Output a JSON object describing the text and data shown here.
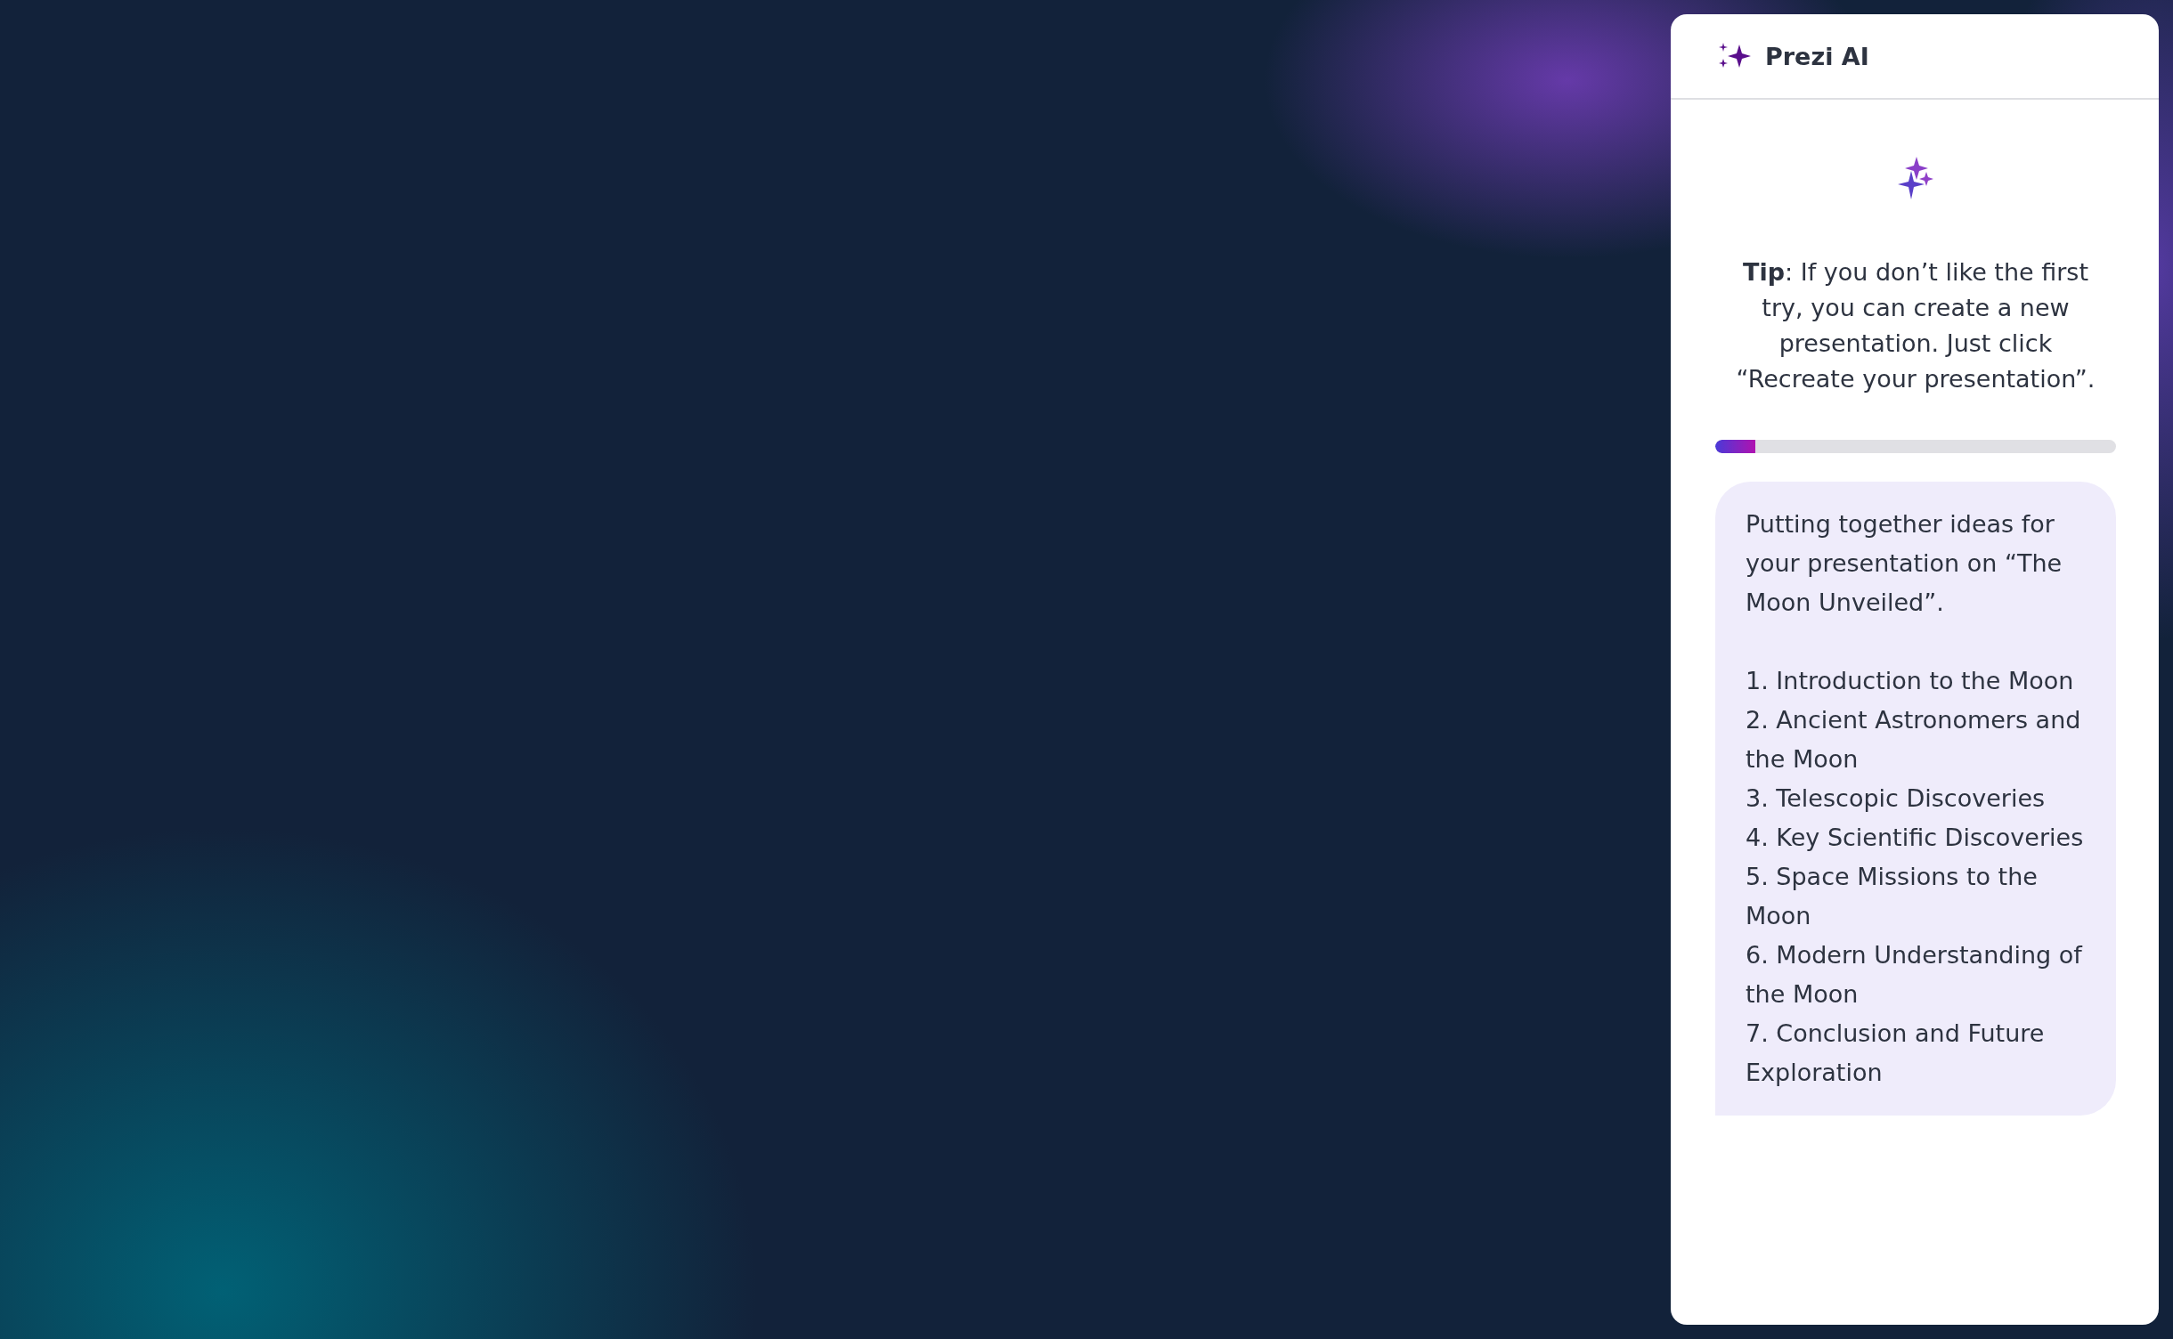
{
  "panel": {
    "title": "Prezi AI",
    "tip": "**Tip**: If you don’t like the first try, you can create a new presentation. Just click “Recreate your presentation”.",
    "progress": {
      "level": 0.1
    },
    "message": {
      "intro": "Putting together ideas for your presentation on “The Moon Unveiled”.",
      "outline": [
        "1. Introduction to the Moon",
        "2. Ancient Astronomers and the Moon",
        "3. Telescopic Discoveries",
        "4. Key Scientific Discoveries",
        "5. Space Missions to the Moon",
        "6. Modern Understanding of the Moon",
        "7. Conclusion and Future Exploration"
      ]
    }
  }
}
